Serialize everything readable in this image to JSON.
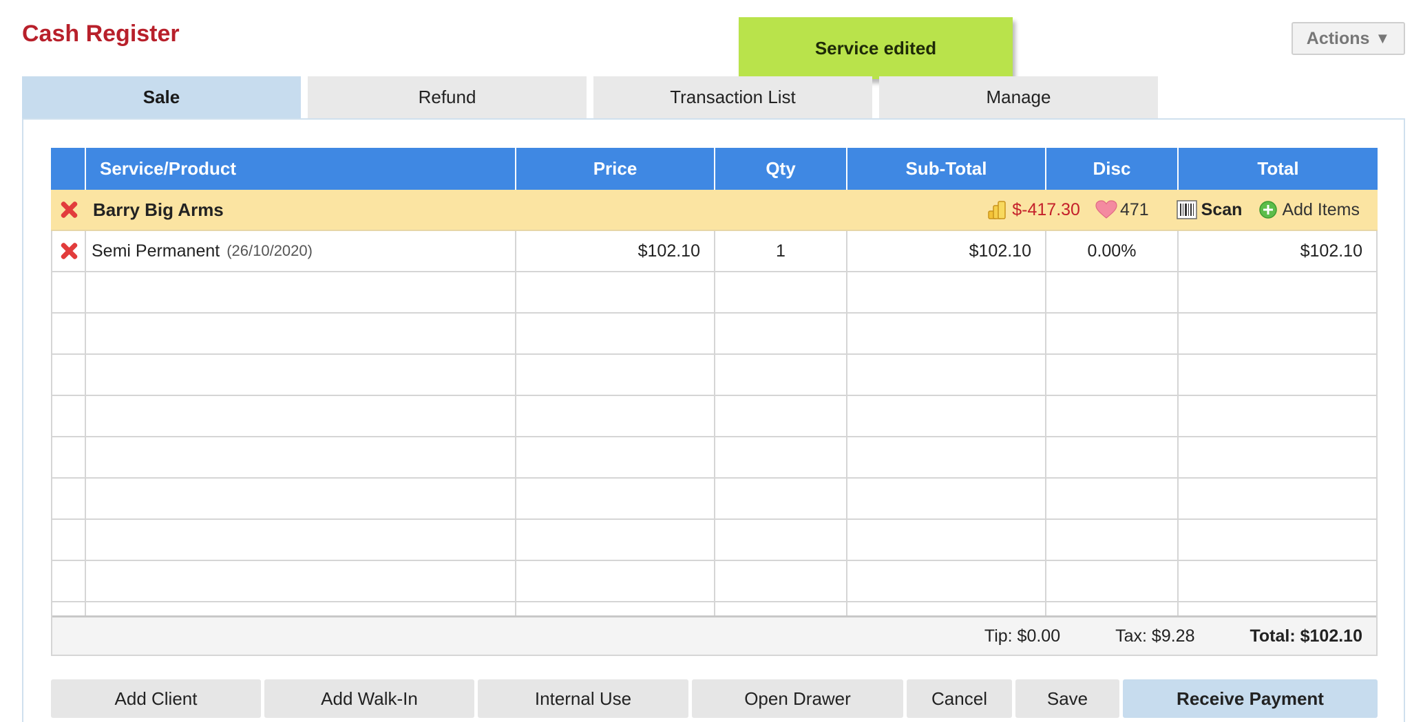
{
  "title": "Cash Register",
  "toast": "Service edited",
  "actions_label": "Actions",
  "tabs": [
    {
      "label": "Sale",
      "active": true
    },
    {
      "label": "Refund",
      "active": false
    },
    {
      "label": "Transaction List",
      "active": false
    },
    {
      "label": "Manage",
      "active": false
    }
  ],
  "table": {
    "headers": [
      "Service/Product",
      "Price",
      "Qty",
      "Sub-Total",
      "Disc",
      "Total"
    ],
    "client": {
      "name": "Barry Big Arms",
      "balance": "$-417.30",
      "points": "471",
      "scan_label": "Scan",
      "add_items_label": "Add Items"
    },
    "items": [
      {
        "name": "Semi Permanent",
        "date": "(26/10/2020)",
        "price": "$102.10",
        "qty": "1",
        "subtotal": "$102.10",
        "disc": "0.00%",
        "total": "$102.10"
      }
    ]
  },
  "totals": {
    "tip": "Tip: $0.00",
    "tax": "Tax: $9.28",
    "total": "Total: $102.10"
  },
  "buttons": {
    "add_client": "Add Client",
    "add_walkin": "Add Walk-In",
    "internal_use": "Internal Use",
    "open_drawer": "Open Drawer",
    "cancel": "Cancel",
    "save": "Save",
    "receive_payment": "Receive Payment"
  },
  "colors": {
    "title": "#b8202b",
    "toast": "#b9e34b",
    "header": "#3f88e3",
    "client_row": "#fbe4a2",
    "active_tab": "#c7dcee",
    "balance": "#c4202a"
  }
}
